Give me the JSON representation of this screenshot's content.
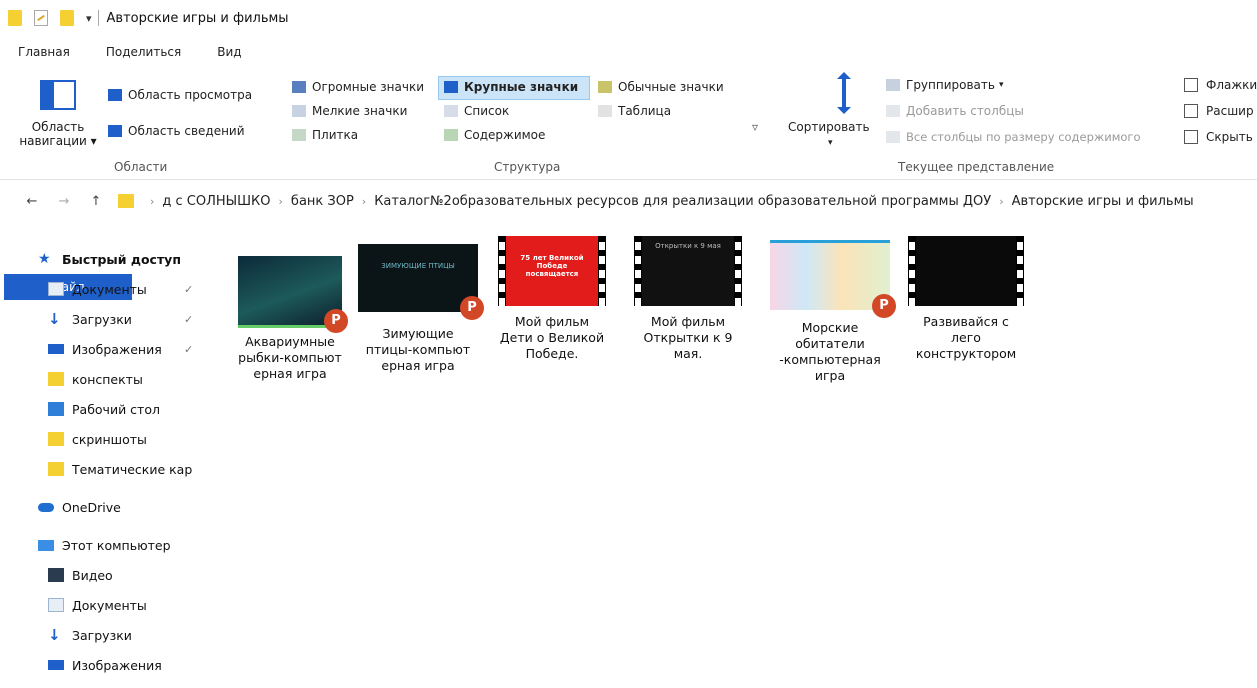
{
  "window": {
    "title": "Авторские игры и фильмы"
  },
  "tabs": [
    "Файл",
    "Главная",
    "Поделиться",
    "Вид"
  ],
  "ribbon": {
    "panes": {
      "nav_pane": "Область навигации",
      "preview_pane": "Область просмотра",
      "details_pane": "Область сведений",
      "group_label": "Области"
    },
    "layout": {
      "extra_large": "Огромные значки",
      "large": "Крупные значки",
      "medium": "Обычные значки",
      "small": "Мелкие значки",
      "list": "Список",
      "details": "Таблица",
      "tiles": "Плитка",
      "content": "Содержимое",
      "group_label": "Структура"
    },
    "current_view": {
      "sort": "Сортировать",
      "group_by": "Группировать",
      "add_columns": "Добавить столбцы",
      "size_columns": "Все столбцы по размеру содержимого",
      "group_label": "Текущее представление"
    },
    "show_hide": {
      "checkboxes": "Флажки",
      "extensions": "Расшир",
      "hidden": "Скрыть"
    }
  },
  "address": {
    "crumbs": [
      "д с СОЛНЫШКО",
      "банк ЗОР",
      "Каталог№2образовательных ресурсов для реализации образовательной программы ДОУ",
      "Авторские игры и фильмы"
    ]
  },
  "sidebar": {
    "quick_access": "Быстрый доступ",
    "items": [
      "Документы",
      "Загрузки",
      "Изображения",
      "конспекты",
      "Рабочий стол",
      "скриншоты",
      "Тематические кар"
    ],
    "onedrive": "OneDrive",
    "this_pc": "Этот компьютер",
    "pc_items": [
      "Видео",
      "Документы",
      "Загрузки",
      "Изображения"
    ]
  },
  "files": [
    {
      "name": "Аквариумные рыбки-компьютерная игра",
      "line1": "Аквариумные",
      "line2": "рыбки-компьют",
      "line3": "ерная игра",
      "kind": "pptx"
    },
    {
      "name": "Зимующие птицы-компьютерная игра",
      "line1": "Зимующие",
      "line2": "птицы-компьют",
      "line3": "ерная игра",
      "kind": "pptx"
    },
    {
      "name": "Мой фильм Дети о Великой Победе.",
      "line1": "Мой фильм",
      "line2": "Дети о Великой",
      "line3": "Победе.",
      "kind": "video"
    },
    {
      "name": "Мой фильм Открытки к 9 мая.",
      "line1": "Мой фильм",
      "line2": "Открытки к 9",
      "line3": "мая.",
      "kind": "video"
    },
    {
      "name": "Морские обитатели -компьютерная игра",
      "line1": "Морские",
      "line2": "обитатели",
      "line3": "-компьютерная",
      "line4": "игра",
      "kind": "pptx"
    },
    {
      "name": "Развивайся с лего конструктором",
      "line1": "Развивайся с",
      "line2": "лего",
      "line3": "конструктором",
      "kind": "video"
    }
  ],
  "thumb_text": {
    "f2": "ЗИМУЮЩИЕ ПТИЦЫ",
    "f3": "75 лет Великой Победе посвящается",
    "f4": "Открытки к 9 мая"
  },
  "colors": {
    "accent": "#1f5fc9",
    "folder": "#f5d033",
    "ppt": "#d24726",
    "selected": "#cce4f7"
  }
}
